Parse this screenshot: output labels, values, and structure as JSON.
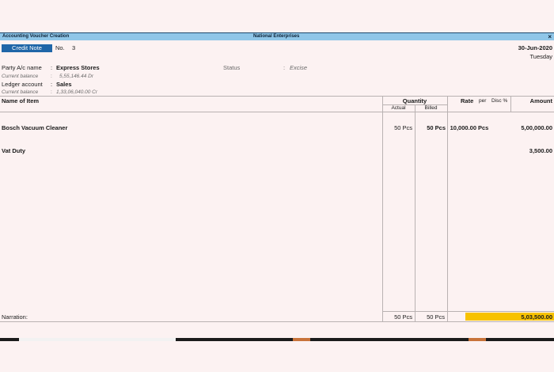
{
  "window": {
    "title": "Accounting Voucher  Creation",
    "company": "National Enterprises",
    "close": "×"
  },
  "voucher": {
    "type": "Credit Note",
    "no_label": "No.",
    "number": "3",
    "date": "30-Jun-2020",
    "day": "Tuesday"
  },
  "party": {
    "label": "Party A/c name",
    "value": "Express Stores",
    "balance_label": "Current balance",
    "balance": "5,55,146.44 Dr"
  },
  "status": {
    "label": "Status",
    "value": "Excise"
  },
  "ledger": {
    "label": "Ledger account",
    "value": "Sales",
    "balance_label": "Current balance",
    "balance": "1,33,06,040.00 Cr"
  },
  "table": {
    "col_item": "Name of Item",
    "col_quantity": "Quantity",
    "col_actual": "Actual",
    "col_billed": "Billed",
    "col_rate": "Rate",
    "col_per": "per",
    "col_disc": "Disc %",
    "col_amount": "Amount",
    "rows": [
      {
        "item": "Bosch Vacuum Cleaner",
        "actual": "50 Pcs",
        "billed": "50 Pcs",
        "rate": "10,000.00",
        "per": "Pcs",
        "amount": "5,00,000.00"
      },
      {
        "item": "Vat Duty",
        "actual": "",
        "billed": "",
        "rate": "",
        "per": "",
        "amount": "3,500.00"
      }
    ]
  },
  "footer": {
    "narration_label": "Narration:",
    "total_actual": "50 Pcs",
    "total_billed": "50 Pcs",
    "total_amount": "5,03,500.00"
  },
  "colors": {
    "title_bar": "#8fc6e8",
    "voucher_type_bg": "#1f66a8",
    "total_highlight": "#f7c200",
    "background": "#fcf2f2"
  }
}
